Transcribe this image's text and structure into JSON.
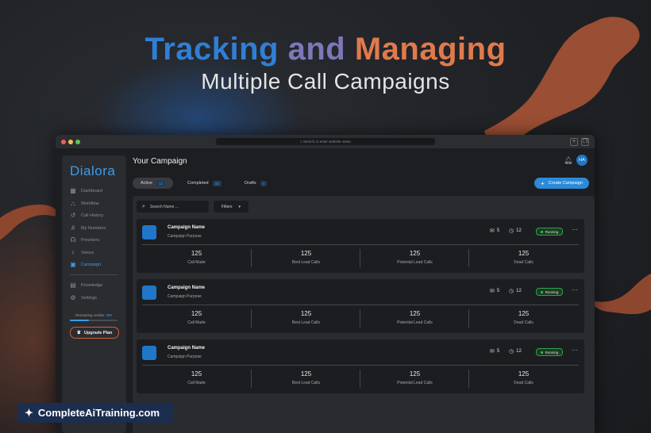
{
  "headline": {
    "line1_w1": "Tracking",
    "line1_w2": "and",
    "line1_w3": "Managing",
    "line2": "Multiple Call Campaigns"
  },
  "browser": {
    "address_placeholder": "Search or enter website name"
  },
  "sidebar": {
    "logo": "Dialora",
    "items": [
      {
        "label": "Dashboard",
        "icon": "grid-icon"
      },
      {
        "label": "Workflow",
        "icon": "workflow-icon"
      },
      {
        "label": "Call History",
        "icon": "history-icon"
      },
      {
        "label": "My Numbers",
        "icon": "hash-icon"
      },
      {
        "label": "Providers",
        "icon": "providers-icon"
      },
      {
        "label": "Voices",
        "icon": "waveform-icon"
      },
      {
        "label": "Campaign",
        "icon": "calendar-icon",
        "active": true
      },
      {
        "label": "Knowledge",
        "icon": "document-icon"
      },
      {
        "label": "Settings",
        "icon": "gear-icon"
      }
    ],
    "credits_label": "Remaining credits:",
    "credits_value": "300",
    "upgrade_label": "Upgrade Plan"
  },
  "main": {
    "title": "Your Campaign",
    "avatar": "HA",
    "tabs": [
      {
        "label": "Active",
        "count": "12"
      },
      {
        "label": "Completed",
        "count": "32"
      },
      {
        "label": "Drafts",
        "count": "4"
      }
    ],
    "create_label": "Create Campaign",
    "search_placeholder": "Search Name ...",
    "filters_label": "Filters"
  },
  "campaigns": [
    {
      "name": "Campaign Name",
      "purpose": "Campaign Purpose",
      "mail_count": "5",
      "clock_count": "12",
      "status": "Running",
      "stats": [
        {
          "value": "125",
          "label": "Call Made"
        },
        {
          "value": "125",
          "label": "Best Lead Calls"
        },
        {
          "value": "125",
          "label": "Potential Lead Calls"
        },
        {
          "value": "125",
          "label": "Dead Calls"
        }
      ]
    },
    {
      "name": "Campaign Name",
      "purpose": "Campaign Purpose",
      "mail_count": "5",
      "clock_count": "12",
      "status": "Running",
      "stats": [
        {
          "value": "125",
          "label": "Call Made"
        },
        {
          "value": "125",
          "label": "Best Lead Calls"
        },
        {
          "value": "125",
          "label": "Potential Lead Calls"
        },
        {
          "value": "125",
          "label": "Dead Calls"
        }
      ]
    },
    {
      "name": "Campaign Name",
      "purpose": "Campaign Purpose",
      "mail_count": "5",
      "clock_count": "12",
      "status": "Running",
      "stats": [
        {
          "value": "125",
          "label": "Call Made"
        },
        {
          "value": "125",
          "label": "Best Lead Calls"
        },
        {
          "value": "125",
          "label": "Potential Lead Calls"
        },
        {
          "value": "125",
          "label": "Dead Calls"
        }
      ]
    }
  ],
  "brand": {
    "label": "CompleteAiTraining.com"
  },
  "colors": {
    "accent_blue": "#2b8ad9",
    "accent_orange": "#e07a4c",
    "running_green": "#36c25a",
    "background": "#1f2125"
  }
}
